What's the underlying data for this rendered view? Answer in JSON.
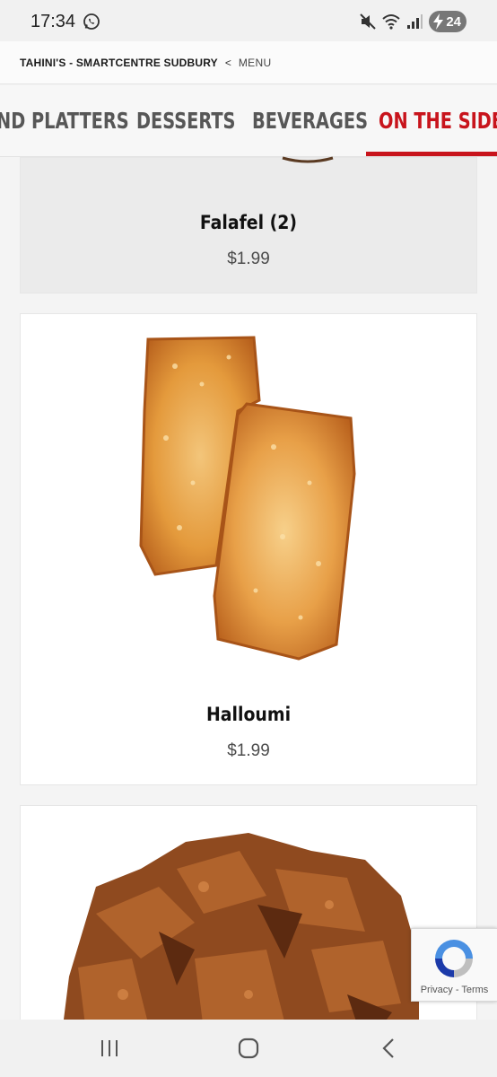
{
  "status_bar": {
    "time": "17:34",
    "battery": "24",
    "icons": [
      "whatsapp-icon",
      "mute-icon",
      "wifi-icon",
      "signal-icon",
      "battery-charging-icon"
    ]
  },
  "breadcrumb": {
    "store": "TAHINI'S - SMARTCENTRE SUDBURY",
    "separator": "<",
    "menu": "MENU"
  },
  "tabs": [
    {
      "label": "ND PLATTERS",
      "active": false
    },
    {
      "label": "DESSERTS",
      "active": false
    },
    {
      "label": "BEVERAGES",
      "active": false
    },
    {
      "label": "ON THE SIDE",
      "active": true
    }
  ],
  "items": [
    {
      "name": "Falafel (2)",
      "price": "$1.99"
    },
    {
      "name": "Halloumi",
      "price": "$1.99"
    },
    {
      "name": "",
      "price": ""
    }
  ],
  "recaptcha": {
    "privacy": "Privacy",
    "separator": " - ",
    "terms": "Terms"
  },
  "navbar": {
    "icons": [
      "recent-apps-icon",
      "home-icon",
      "back-icon"
    ]
  },
  "colors": {
    "accent": "#c8141c",
    "tab_inactive": "#575757",
    "background": "#f4f4f4"
  }
}
